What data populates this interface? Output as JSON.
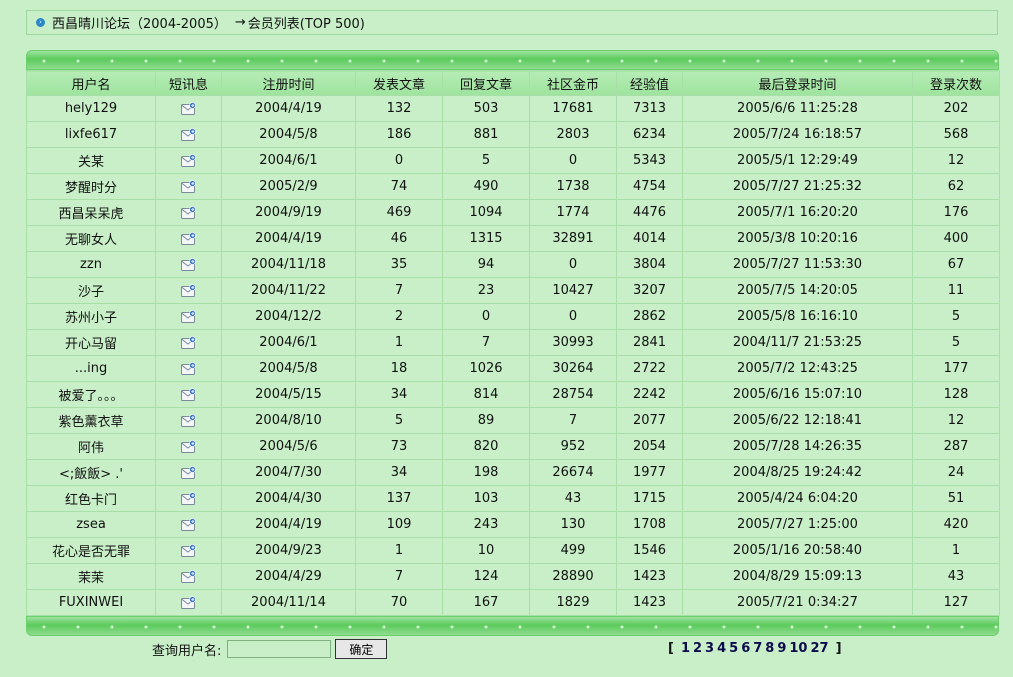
{
  "breadcrumb": {
    "forum": "西昌晴川论坛（2004-2005）",
    "arrow": "→",
    "page": "会员列表(TOP 500)"
  },
  "table": {
    "headers": [
      "用户名",
      "短讯息",
      "注册时间",
      "发表文章",
      "回复文章",
      "社区金币",
      "经验值",
      "最后登录时间",
      "登录次数"
    ],
    "rows": [
      [
        "hely129",
        "2004/4/19",
        "132",
        "503",
        "17681",
        "7313",
        "2005/6/6 11:25:28",
        "202"
      ],
      [
        "lixfe617",
        "2004/5/8",
        "186",
        "881",
        "2803",
        "6234",
        "2005/7/24 16:18:57",
        "568"
      ],
      [
        "关某",
        "2004/6/1",
        "0",
        "5",
        "0",
        "5343",
        "2005/5/1 12:29:49",
        "12"
      ],
      [
        "梦醒时分",
        "2005/2/9",
        "74",
        "490",
        "1738",
        "4754",
        "2005/7/27 21:25:32",
        "62"
      ],
      [
        "西昌呆呆虎",
        "2004/9/19",
        "469",
        "1094",
        "1774",
        "4476",
        "2005/7/1 16:20:20",
        "176"
      ],
      [
        "无聊女人",
        "2004/4/19",
        "46",
        "1315",
        "32891",
        "4014",
        "2005/3/8 10:20:16",
        "400"
      ],
      [
        "zzn",
        "2004/11/18",
        "35",
        "94",
        "0",
        "3804",
        "2005/7/27 11:53:30",
        "67"
      ],
      [
        "沙子",
        "2004/11/22",
        "7",
        "23",
        "10427",
        "3207",
        "2005/7/5 14:20:05",
        "11"
      ],
      [
        "苏州小子",
        "2004/12/2",
        "2",
        "0",
        "0",
        "2862",
        "2005/5/8 16:16:10",
        "5"
      ],
      [
        "开心马留",
        "2004/6/1",
        "1",
        "7",
        "30993",
        "2841",
        "2004/11/7 21:53:25",
        "5"
      ],
      [
        "...ing",
        "2004/5/8",
        "18",
        "1026",
        "30264",
        "2722",
        "2005/7/2 12:43:25",
        "177"
      ],
      [
        "被爱了。。。",
        "2004/5/15",
        "34",
        "814",
        "28754",
        "2242",
        "2005/6/16 15:07:10",
        "128"
      ],
      [
        "紫色薰衣草",
        "2004/8/10",
        "5",
        "89",
        "7",
        "2077",
        "2005/6/22 12:18:41",
        "12"
      ],
      [
        "阿伟",
        "2004/5/6",
        "73",
        "820",
        "952",
        "2054",
        "2005/7/28 14:26:35",
        "287"
      ],
      [
        "<;飯飯> .'",
        "2004/7/30",
        "34",
        "198",
        "26674",
        "1977",
        "2004/8/25 19:24:42",
        "24"
      ],
      [
        "红色卡门",
        "2004/4/30",
        "137",
        "103",
        "43",
        "1715",
        "2005/4/24 6:04:20",
        "51"
      ],
      [
        "zsea",
        "2004/4/19",
        "109",
        "243",
        "130",
        "1708",
        "2005/7/27 1:25:00",
        "420"
      ],
      [
        "花心是否无罪",
        "2004/9/23",
        "1",
        "10",
        "499",
        "1546",
        "2005/1/16 20:58:40",
        "1"
      ],
      [
        "茉茉",
        "2004/4/29",
        "7",
        "124",
        "28890",
        "1423",
        "2004/8/29 15:09:13",
        "43"
      ],
      [
        "FUXINWEI",
        "2004/11/14",
        "70",
        "167",
        "1829",
        "1423",
        "2005/7/21 0:34:27",
        "127"
      ]
    ]
  },
  "search": {
    "label": "查询用户名:",
    "placeholder": "",
    "button": "确定"
  },
  "pager": {
    "open": "[",
    "pages": [
      "1",
      "2",
      "3",
      "4",
      "5",
      "6",
      "7",
      "8",
      "9",
      "10",
      "27"
    ],
    "close": "]"
  },
  "icons": {
    "breadcrumb_bullet": "chevron-right-icon",
    "message": "send-message-icon"
  }
}
